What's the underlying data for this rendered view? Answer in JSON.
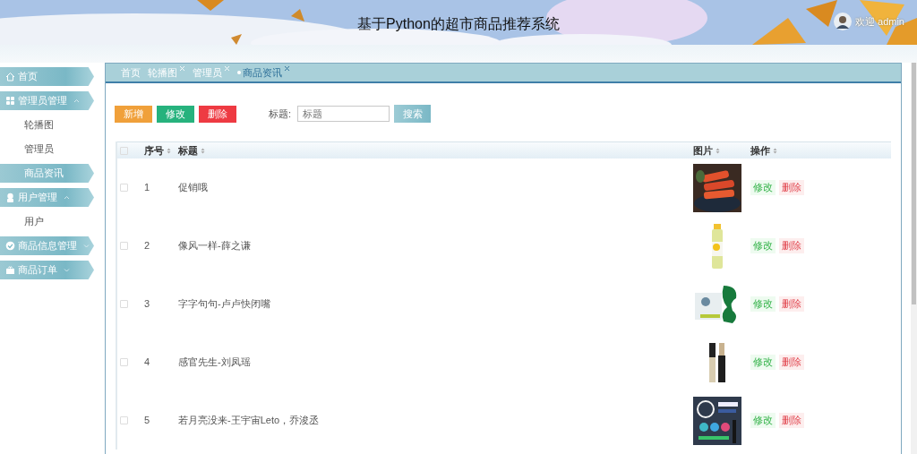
{
  "header": {
    "title": "基于Python的超市商品推荐系统",
    "welcome": "欢迎 admin"
  },
  "sidebar": {
    "items": [
      {
        "label": "首页",
        "kind": "link"
      },
      {
        "label": "管理员管理",
        "kind": "group",
        "expanded": true,
        "children": [
          {
            "label": "轮播图",
            "selected": false
          },
          {
            "label": "管理员",
            "selected": false
          },
          {
            "label": "商品资讯",
            "selected": true
          }
        ]
      },
      {
        "label": "用户管理",
        "kind": "group",
        "expanded": true,
        "children": [
          {
            "label": "用户",
            "selected": false
          }
        ]
      },
      {
        "label": "商品信息管理",
        "kind": "group",
        "expanded": false
      },
      {
        "label": "商品订单",
        "kind": "group",
        "expanded": false
      }
    ]
  },
  "tabs": [
    {
      "label": "首页",
      "closable": false,
      "selected": false
    },
    {
      "label": "轮播图",
      "closable": true,
      "selected": false
    },
    {
      "label": "管理员",
      "closable": true,
      "selected": false
    },
    {
      "label": "商品资讯",
      "closable": true,
      "selected": true
    }
  ],
  "toolbar": {
    "buttons": [
      {
        "label": "新增",
        "kind": "add"
      },
      {
        "label": "修改",
        "kind": "edit"
      },
      {
        "label": "删除",
        "kind": "delete"
      }
    ],
    "search_label": "标题:",
    "search_placeholder": "标题",
    "search_button": "搜索"
  },
  "table": {
    "header_checked": false,
    "columns": [
      "序号",
      "标题",
      "图片",
      "操作"
    ],
    "rows": [
      {
        "checked": false,
        "index": "1",
        "title": "促销哦",
        "actions": [
          {
            "label": "修改",
            "kind": "edit"
          },
          {
            "label": "删除",
            "kind": "delete"
          }
        ]
      },
      {
        "checked": false,
        "index": "2",
        "title": "像风一样-薛之谦",
        "actions": [
          {
            "label": "修改",
            "kind": "edit"
          },
          {
            "label": "删除",
            "kind": "delete"
          }
        ]
      },
      {
        "checked": false,
        "index": "3",
        "title": "字字句句-卢卢快闭嘴",
        "actions": [
          {
            "label": "修改",
            "kind": "edit"
          },
          {
            "label": "删除",
            "kind": "delete"
          }
        ]
      },
      {
        "checked": false,
        "index": "4",
        "title": "感官先生-刘凤瑶",
        "actions": [
          {
            "label": "修改",
            "kind": "edit"
          },
          {
            "label": "删除",
            "kind": "delete"
          }
        ]
      },
      {
        "checked": false,
        "index": "5",
        "title": "若月亮没来-王宇宙Leto，乔浚丞",
        "actions": [
          {
            "label": "修改",
            "kind": "edit"
          },
          {
            "label": "删除",
            "kind": "delete"
          }
        ]
      }
    ]
  }
}
